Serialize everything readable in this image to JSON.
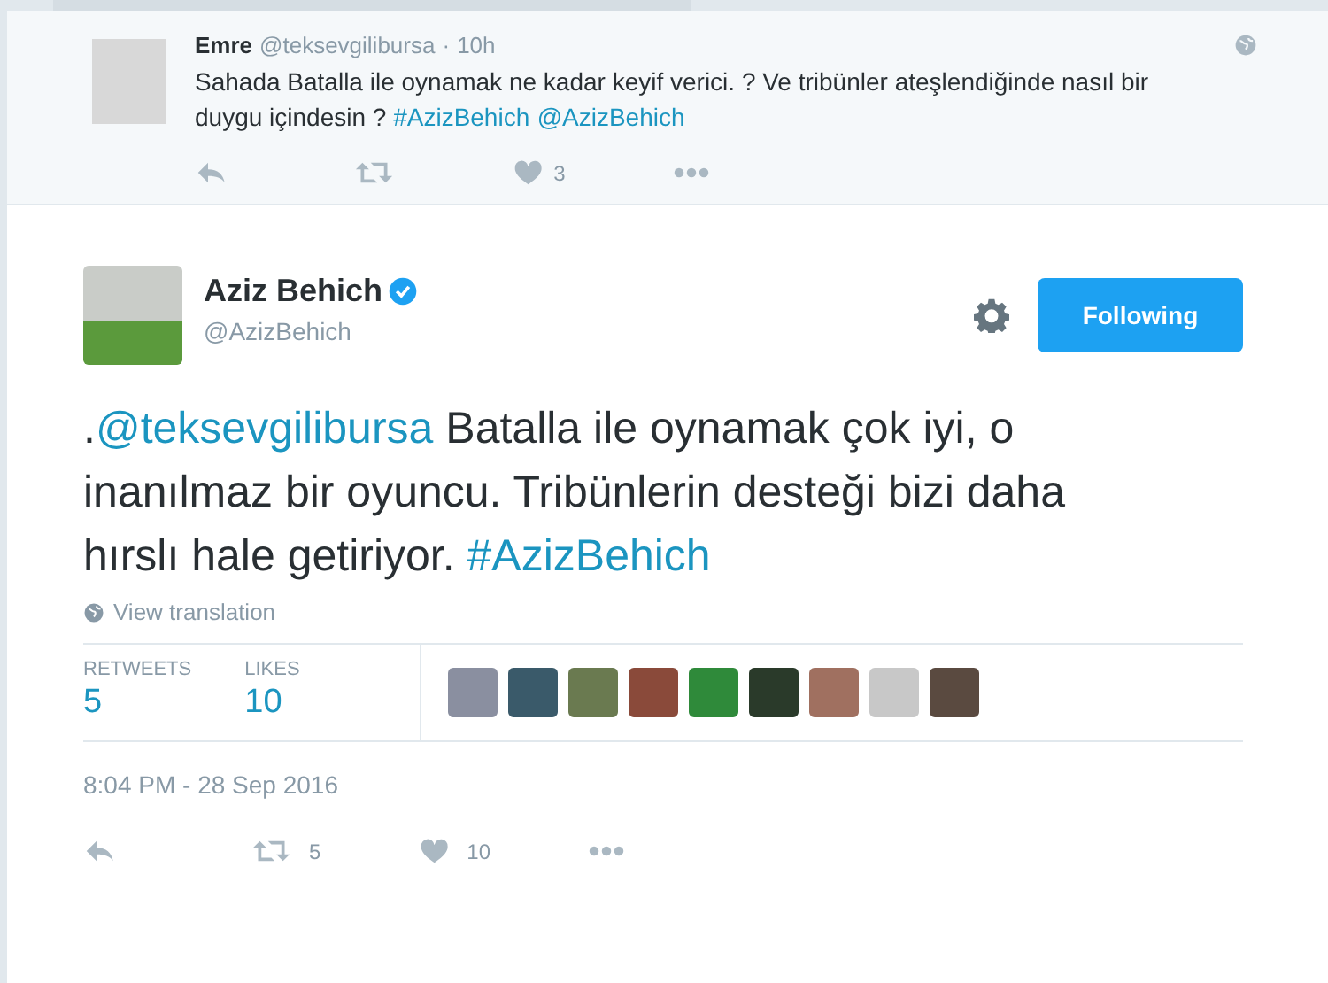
{
  "parent_tweet": {
    "name": "Emre",
    "handle": "@teksevgilibursa",
    "separator": "·",
    "time": "10h",
    "text": [
      {
        "kind": "text",
        "s": "Sahada Batalla ile oynamak ne kadar keyif verici. ? Ve tribünler ateşlendiğinde nasıl bir duygu içindesin ? "
      },
      {
        "kind": "link",
        "s": "#AzizBehich"
      },
      {
        "kind": "link",
        "s": "@AzizBehich"
      }
    ],
    "actions": [
      {
        "kind": "reply"
      },
      {
        "kind": "retweet"
      },
      {
        "kind": "like",
        "count": "3"
      },
      {
        "kind": "more"
      }
    ]
  },
  "tweet": {
    "name": "Aziz Behich",
    "verified": true,
    "handle": "@AzizBehich",
    "follow_button": "Following",
    "text": [
      {
        "kind": "text",
        "s": "."
      },
      {
        "kind": "link",
        "s": "@teksevgilibursa"
      },
      {
        "kind": "text",
        "s": " Batalla ile oynamak çok iyi, o inanılmaz bir oyuncu. Tribünlerin desteği bizi daha hırslı hale getiriyor. "
      },
      {
        "kind": "link",
        "s": "#AzizBehich"
      }
    ],
    "translation": "View translation",
    "stats": [
      {
        "label": "RETWEETS",
        "value": "5"
      },
      {
        "label": "LIKES",
        "value": "10"
      }
    ],
    "timestamp": "8:04 PM - 28 Sep 2016",
    "actions": [
      {
        "kind": "reply"
      },
      {
        "kind": "retweet",
        "count": "5"
      },
      {
        "kind": "like",
        "count": "10"
      },
      {
        "kind": "more"
      }
    ]
  }
}
